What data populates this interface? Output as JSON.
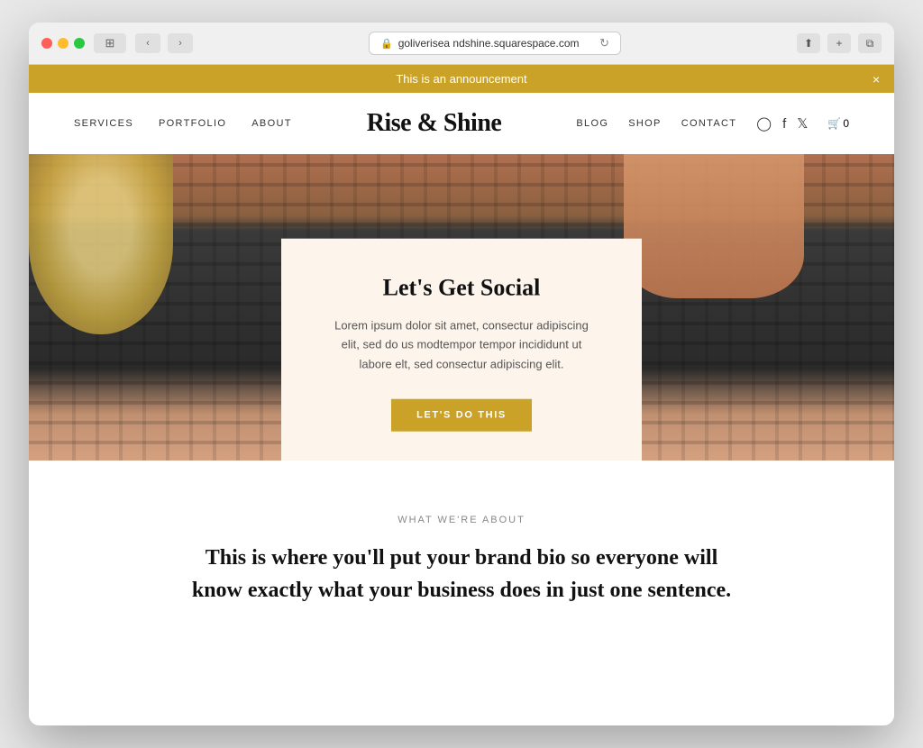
{
  "browser": {
    "url": "goliverisea ndshine.squarespace.com",
    "url_display": "goliverisea ndshine.squarespace.com"
  },
  "announcement": {
    "text": "This is an announcement",
    "close_btn": "×"
  },
  "nav": {
    "logo": "Rise & Shine",
    "left_items": [
      {
        "label": "SERVICES",
        "id": "services"
      },
      {
        "label": "PORTFOLIO",
        "id": "portfolio"
      },
      {
        "label": "ABOUT",
        "id": "about"
      }
    ],
    "right_items": [
      {
        "label": "BLOG",
        "id": "blog"
      },
      {
        "label": "SHOP",
        "id": "shop"
      },
      {
        "label": "CONTACT",
        "id": "contact"
      }
    ],
    "cart_count": "0"
  },
  "hero": {
    "card": {
      "title": "Let's Get Social",
      "body": "Lorem ipsum dolor sit amet, consectur adipiscing elit, sed do us modtempor tempor incididunt ut labore elt, sed consectur adipiscing elit.",
      "cta_label": "LET'S DO THIS"
    }
  },
  "about": {
    "label": "WHAT WE'RE ABOUT",
    "headline": "This is where you'll put your brand bio so everyone will know exactly what your business does in just one sentence."
  }
}
